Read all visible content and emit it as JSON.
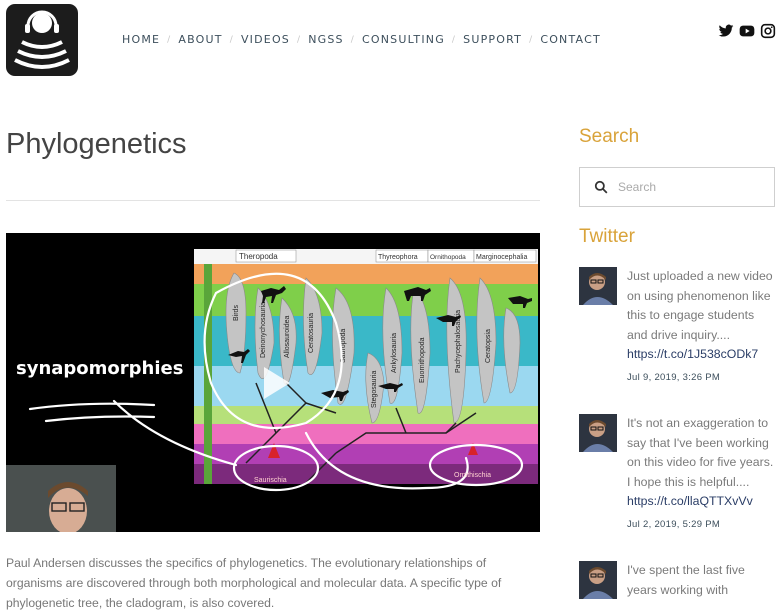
{
  "nav": {
    "items": [
      "HOME",
      "ABOUT",
      "VIDEOS",
      "NGSS",
      "CONSULTING",
      "SUPPORT",
      "CONTACT"
    ]
  },
  "social": {
    "icons": [
      "twitter-icon",
      "youtube-icon",
      "instagram-icon"
    ]
  },
  "page": {
    "title": "Phylogenetics",
    "description": "Paul Andersen discusses the specifics of phylogenetics. The evolutionary relationships of organisms are discovered through both morphological and molecular data. A specific type of phylogenetic tree, the cladogram, is also covered."
  },
  "video": {
    "overlay_text": "synapomorphies",
    "top_labels": [
      "Theropoda",
      "Thyreophora",
      "Ornithopoda",
      "Marginocephalia"
    ],
    "branch_labels": [
      "Birds",
      "Deinonychosauria",
      "Allosauroidea",
      "Ceratosauria",
      "Sauropoda",
      "Stegosauria",
      "Ankylosauria",
      "Euornithopoda",
      "Pachycephalosauria",
      "Ceratopsia"
    ],
    "bottom_labels": [
      "Saurischia",
      "Ornithischia"
    ]
  },
  "sidebar": {
    "search_heading": "Search",
    "search_placeholder": "Search",
    "twitter_heading": "Twitter",
    "tweets": [
      {
        "text": "Just uploaded a new video on using phenomenon like this to engage students and drive inquiry....",
        "link": "https://t.co/1J538cODk7",
        "date": "Jul 9, 2019, 3:26 PM"
      },
      {
        "text": "It's not an exaggeration to say that I've been working on this video for five years. I hope this is helpful....",
        "link": "https://t.co/llaQTTXvVv",
        "date": "Jul 2, 2019, 5:29 PM"
      },
      {
        "text": "I've spent the last five years working with",
        "link": "",
        "date": ""
      }
    ]
  },
  "colors": {
    "accent": "#d9a33a",
    "nav_text": "#3d4f5c",
    "link": "#2a3d66"
  }
}
